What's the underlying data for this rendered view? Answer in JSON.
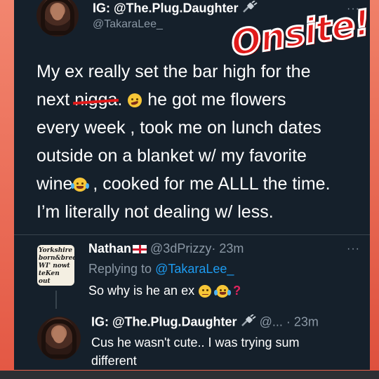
{
  "tweet": {
    "author_name": "IG: @The.Plug.Daughter",
    "author_handle": "@TakaraLee_",
    "text_line1": "My ex really set the bar high for the",
    "text_line2a": "next ",
    "text_line2_censored": "n",
    "text_line2_censored_b": "igga",
    "text_line2b": ". ",
    "text_line2c": " he got me flowers",
    "text_line3": "every week , took me on lunch dates",
    "text_line4": "outside on a blanket w/ my favorite",
    "text_line5a": "wine",
    "text_line5b": " , cooked for me ALLL the time.",
    "text_line6": "I’m literally not dealing w/ less."
  },
  "watermark": "Onsite!",
  "reply1": {
    "author_name": "Nathan",
    "author_handle": "@3dPrizzy",
    "time": "· 23m",
    "replying_prefix": "Replying to ",
    "replying_to": "@TakaraLee_",
    "text": "So why is he an ex ",
    "avatar_sign": [
      "Yorkshire",
      "born&bred",
      "WI' nowt",
      "teKen out"
    ]
  },
  "reply2": {
    "author_name": "IG: @The.Plug.Daughter",
    "author_handle": "@...",
    "time": "· 23m",
    "text_line1": "Cus he wasn't cute.. I was trying sum",
    "text_line2": "different"
  },
  "colors": {
    "background": "#15202b",
    "link": "#1d9bf0",
    "frame": "#e9614b",
    "watermark": "#e11b1b"
  },
  "icons": [
    "plug-icon",
    "more-icon",
    "england-flag-icon",
    "woozy-face-emoji",
    "laughing-tears-emoji",
    "thinking-face-emoji",
    "red-question-mark-emoji"
  ]
}
